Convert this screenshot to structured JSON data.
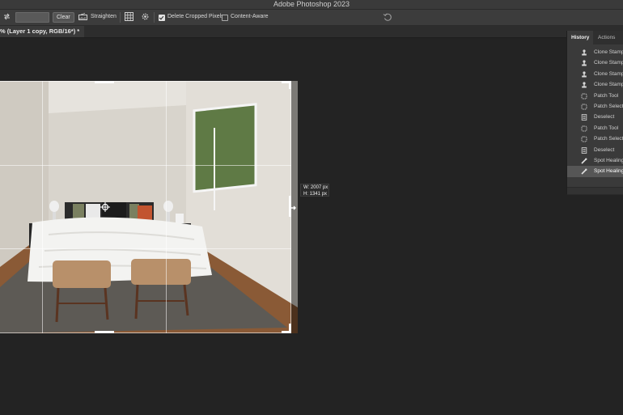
{
  "window": {
    "title": "Adobe Photoshop 2023"
  },
  "options_bar": {
    "clear_label": "Clear",
    "straighten_label": "Straighten",
    "delete_cropped_pixels": {
      "label": "Delete Cropped Pixels",
      "checked": true
    },
    "content_aware": {
      "label": "Content-Aware",
      "checked": false
    },
    "icons": [
      "swap-icon",
      "straighten-icon",
      "overlay-grid-icon",
      "gear-icon",
      "reset-icon"
    ]
  },
  "document_tab": {
    "title": "% (Layer 1 copy, RGB/16*) *"
  },
  "canvas": {
    "tooltip": {
      "width": "W: 2007 px",
      "height": "H: 1341 px"
    },
    "background_color": "#232323"
  },
  "history_panel": {
    "tabs": [
      {
        "label": "History",
        "active": true
      },
      {
        "label": "Actions",
        "active": false
      }
    ],
    "items": [
      {
        "label": "Clone Stamp",
        "icon": "clone-stamp-icon",
        "selected": false
      },
      {
        "label": "Clone Stamp",
        "icon": "clone-stamp-icon",
        "selected": false
      },
      {
        "label": "Clone Stamp",
        "icon": "clone-stamp-icon",
        "selected": false
      },
      {
        "label": "Clone Stamp",
        "icon": "clone-stamp-icon",
        "selected": false
      },
      {
        "label": "Patch Tool",
        "icon": "patch-tool-icon",
        "selected": false
      },
      {
        "label": "Patch Selection",
        "icon": "patch-tool-icon",
        "selected": false
      },
      {
        "label": "Deselect",
        "icon": "document-icon",
        "selected": false
      },
      {
        "label": "Patch Tool",
        "icon": "patch-tool-icon",
        "selected": false
      },
      {
        "label": "Patch Selection",
        "icon": "patch-tool-icon",
        "selected": false
      },
      {
        "label": "Deselect",
        "icon": "document-icon",
        "selected": false
      },
      {
        "label": "Spot Healing Brush",
        "icon": "spot-healing-icon",
        "selected": false
      },
      {
        "label": "Spot Healing Brush",
        "icon": "spot-healing-icon",
        "selected": true
      }
    ]
  }
}
